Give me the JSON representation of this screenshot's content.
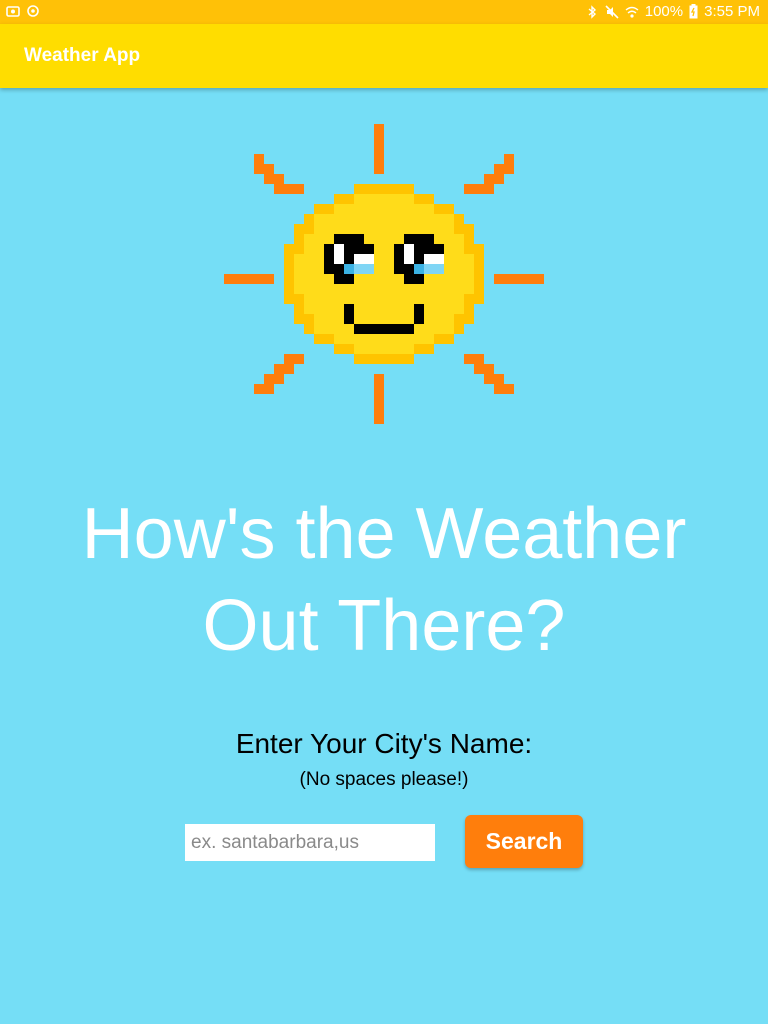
{
  "status_bar": {
    "battery": "100%",
    "time": "3:55 PM",
    "icons": [
      "screenshot-icon",
      "sync-icon",
      "bluetooth-icon",
      "mute-icon",
      "wifi-icon",
      "battery-icon"
    ]
  },
  "app_bar": {
    "title": "Weather App"
  },
  "hero": {
    "icon": "smiling-sun-icon",
    "headline_line1": "How's the Weather",
    "headline_line2": "Out There?"
  },
  "form": {
    "prompt": "Enter Your City's Name:",
    "hint": "(No spaces please!)",
    "city_placeholder": "ex. santabarbara,us",
    "city_value": "",
    "search_label": "Search"
  },
  "colors": {
    "background": "#75DEF6",
    "status_bar": "#FFC107",
    "app_bar": "#FFDD00",
    "accent": "#FF7E0C",
    "sun": "#FFD600",
    "sun_outline": "#FFC400"
  }
}
